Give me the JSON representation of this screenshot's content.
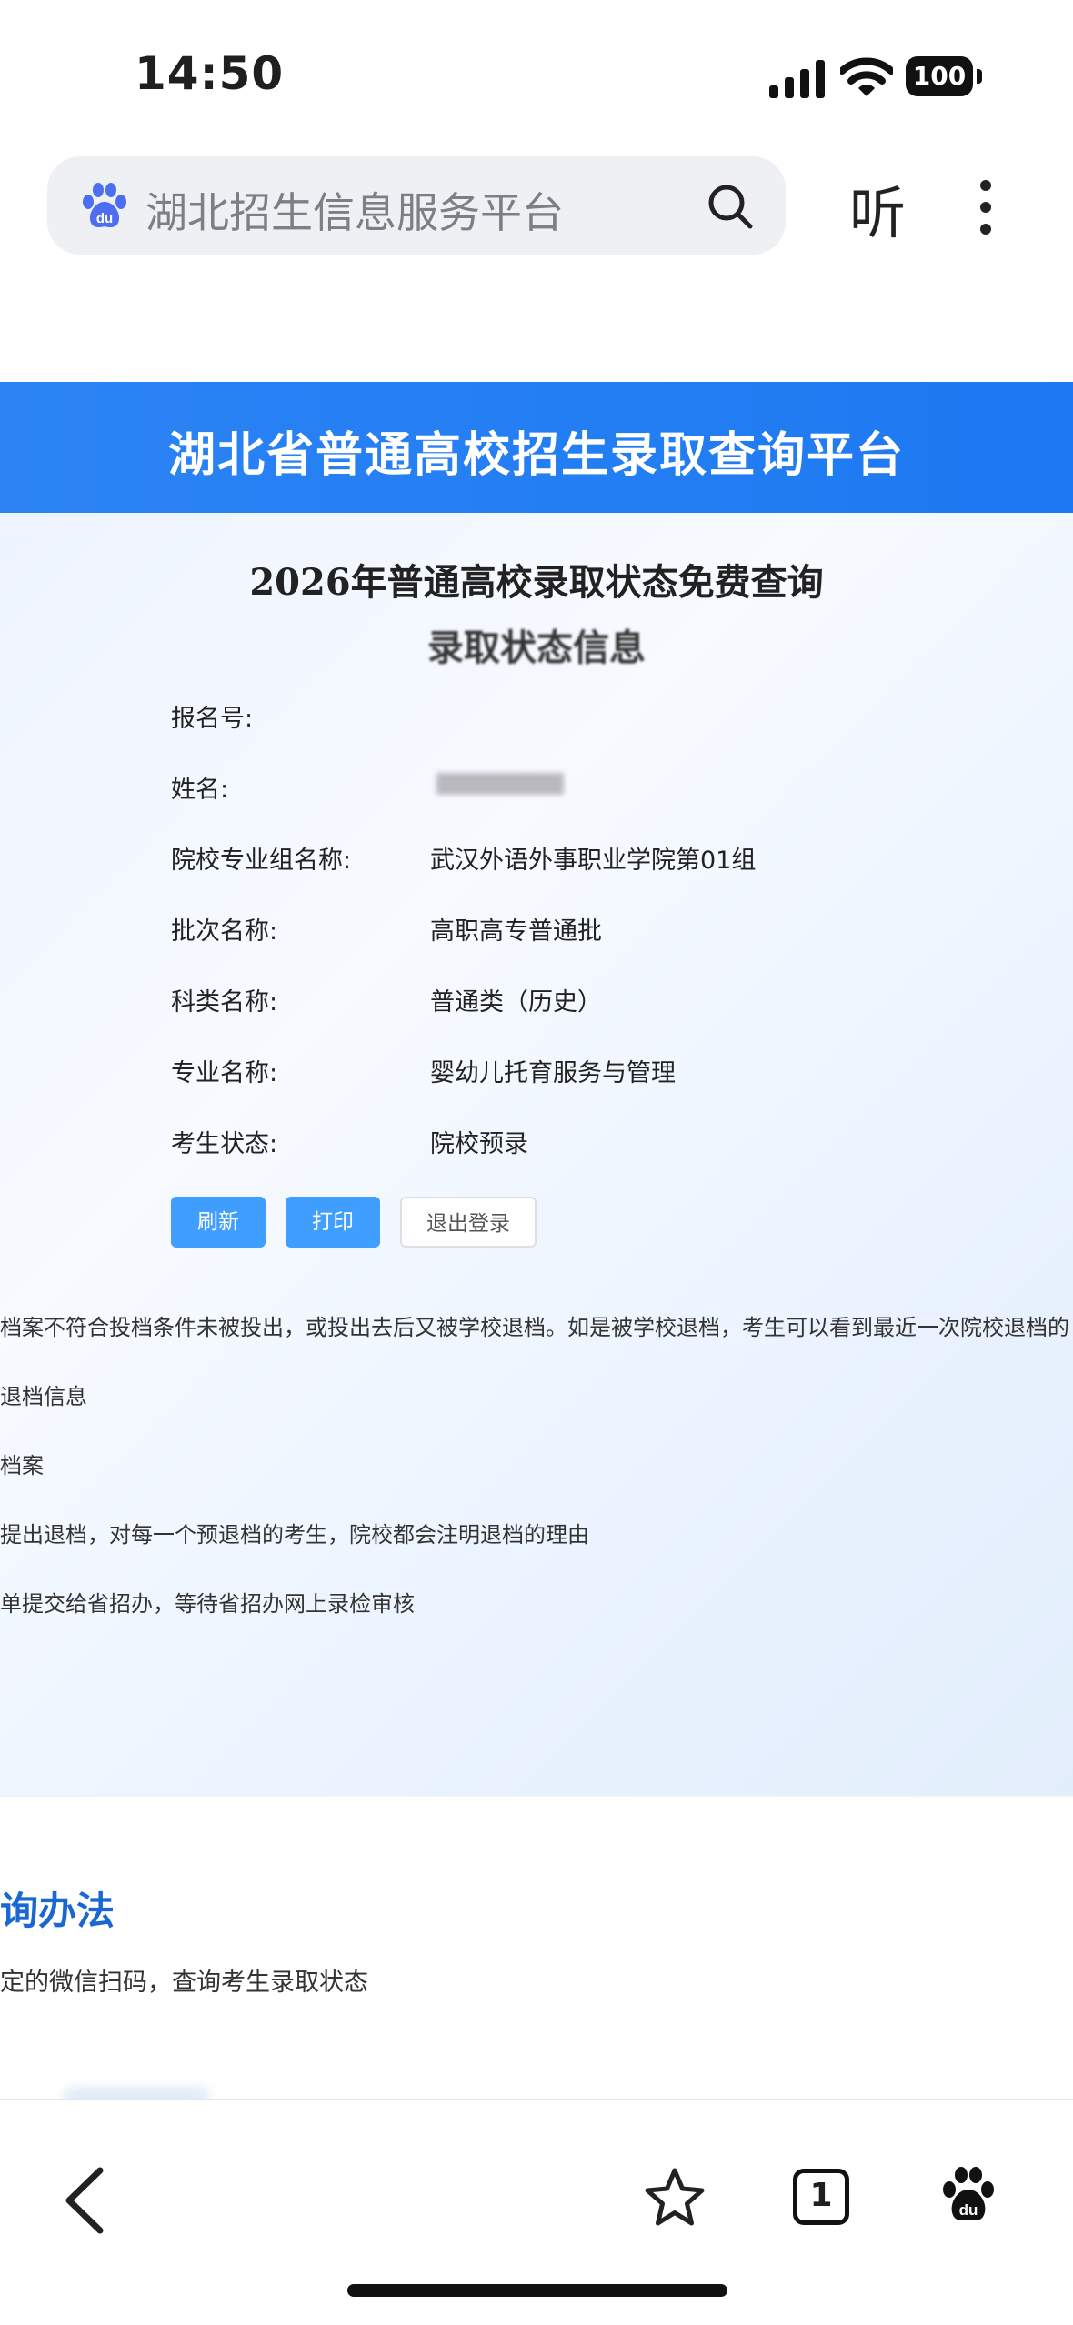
{
  "status_bar": {
    "time": "14:50",
    "battery": "100"
  },
  "browser": {
    "search_text": "湖北招生信息服务平台",
    "listen_label": "听",
    "tab_count": "1"
  },
  "page": {
    "banner_title": "湖北省普通高校招生录取查询平台",
    "query_title": "2026年普通高校录取状态免费查询",
    "info_title": "录取状态信息",
    "fields": [
      {
        "label": "报名号:",
        "value": ""
      },
      {
        "label": "姓名:",
        "value": ""
      },
      {
        "label": "院校专业组名称:",
        "value": "武汉外语外事职业学院第01组"
      },
      {
        "label": "批次名称:",
        "value": "高职高专普通批"
      },
      {
        "label": "科类名称:",
        "value": "普通类（历史）"
      },
      {
        "label": "专业名称:",
        "value": "婴幼儿托育服务与管理"
      },
      {
        "label": "考生状态:",
        "value": "院校预录"
      }
    ],
    "buttons": {
      "refresh": "刷新",
      "print": "打印",
      "logout": "退出登录"
    },
    "notes": [
      "档案不符合投档条件未被投出，或投出去后又被学校退档。如是被学校退档，考生可以看到最近一次院校退档的",
      "退档信息",
      "档案",
      "提出退档，对每一个预退档的考生，院校都会注明退档的理由",
      "单提交给省招办，等待省招办网上录检审核"
    ],
    "method_title": "询办法",
    "method_text": "定的微信扫码，查询考生录取状态"
  }
}
